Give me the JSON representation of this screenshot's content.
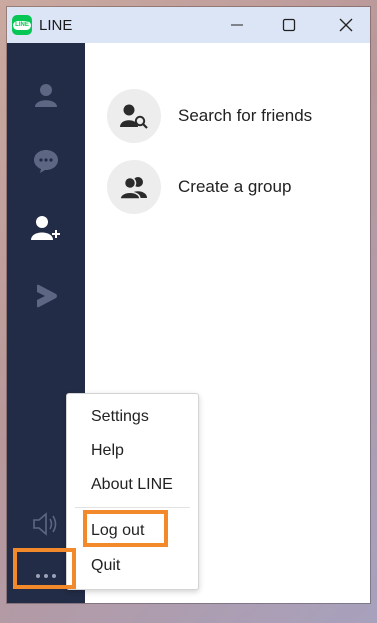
{
  "window": {
    "title": "LINE",
    "logo_text": "LINE"
  },
  "sidebar": {
    "items": [
      {
        "icon": "person-icon",
        "label": "Friends"
      },
      {
        "icon": "chat-bubble-icon",
        "label": "Chats"
      },
      {
        "icon": "add-friend-icon",
        "label": "Add friends"
      },
      {
        "icon": "line-play-icon",
        "label": "LINE VOOM"
      }
    ],
    "bottom": {
      "speaker": "speaker-icon",
      "more": "more-dots-icon"
    }
  },
  "content": {
    "actions": [
      {
        "icon": "search-friends-icon",
        "label": "Search for friends"
      },
      {
        "icon": "group-icon",
        "label": "Create a group"
      }
    ]
  },
  "menu": {
    "items": [
      "Settings",
      "Help",
      "About LINE",
      "Log out",
      "Quit"
    ]
  },
  "colors": {
    "sidebar": "#232c46",
    "titlebar": "#dce5f6",
    "highlight": "#f28a2c",
    "brand": "#06c755"
  }
}
